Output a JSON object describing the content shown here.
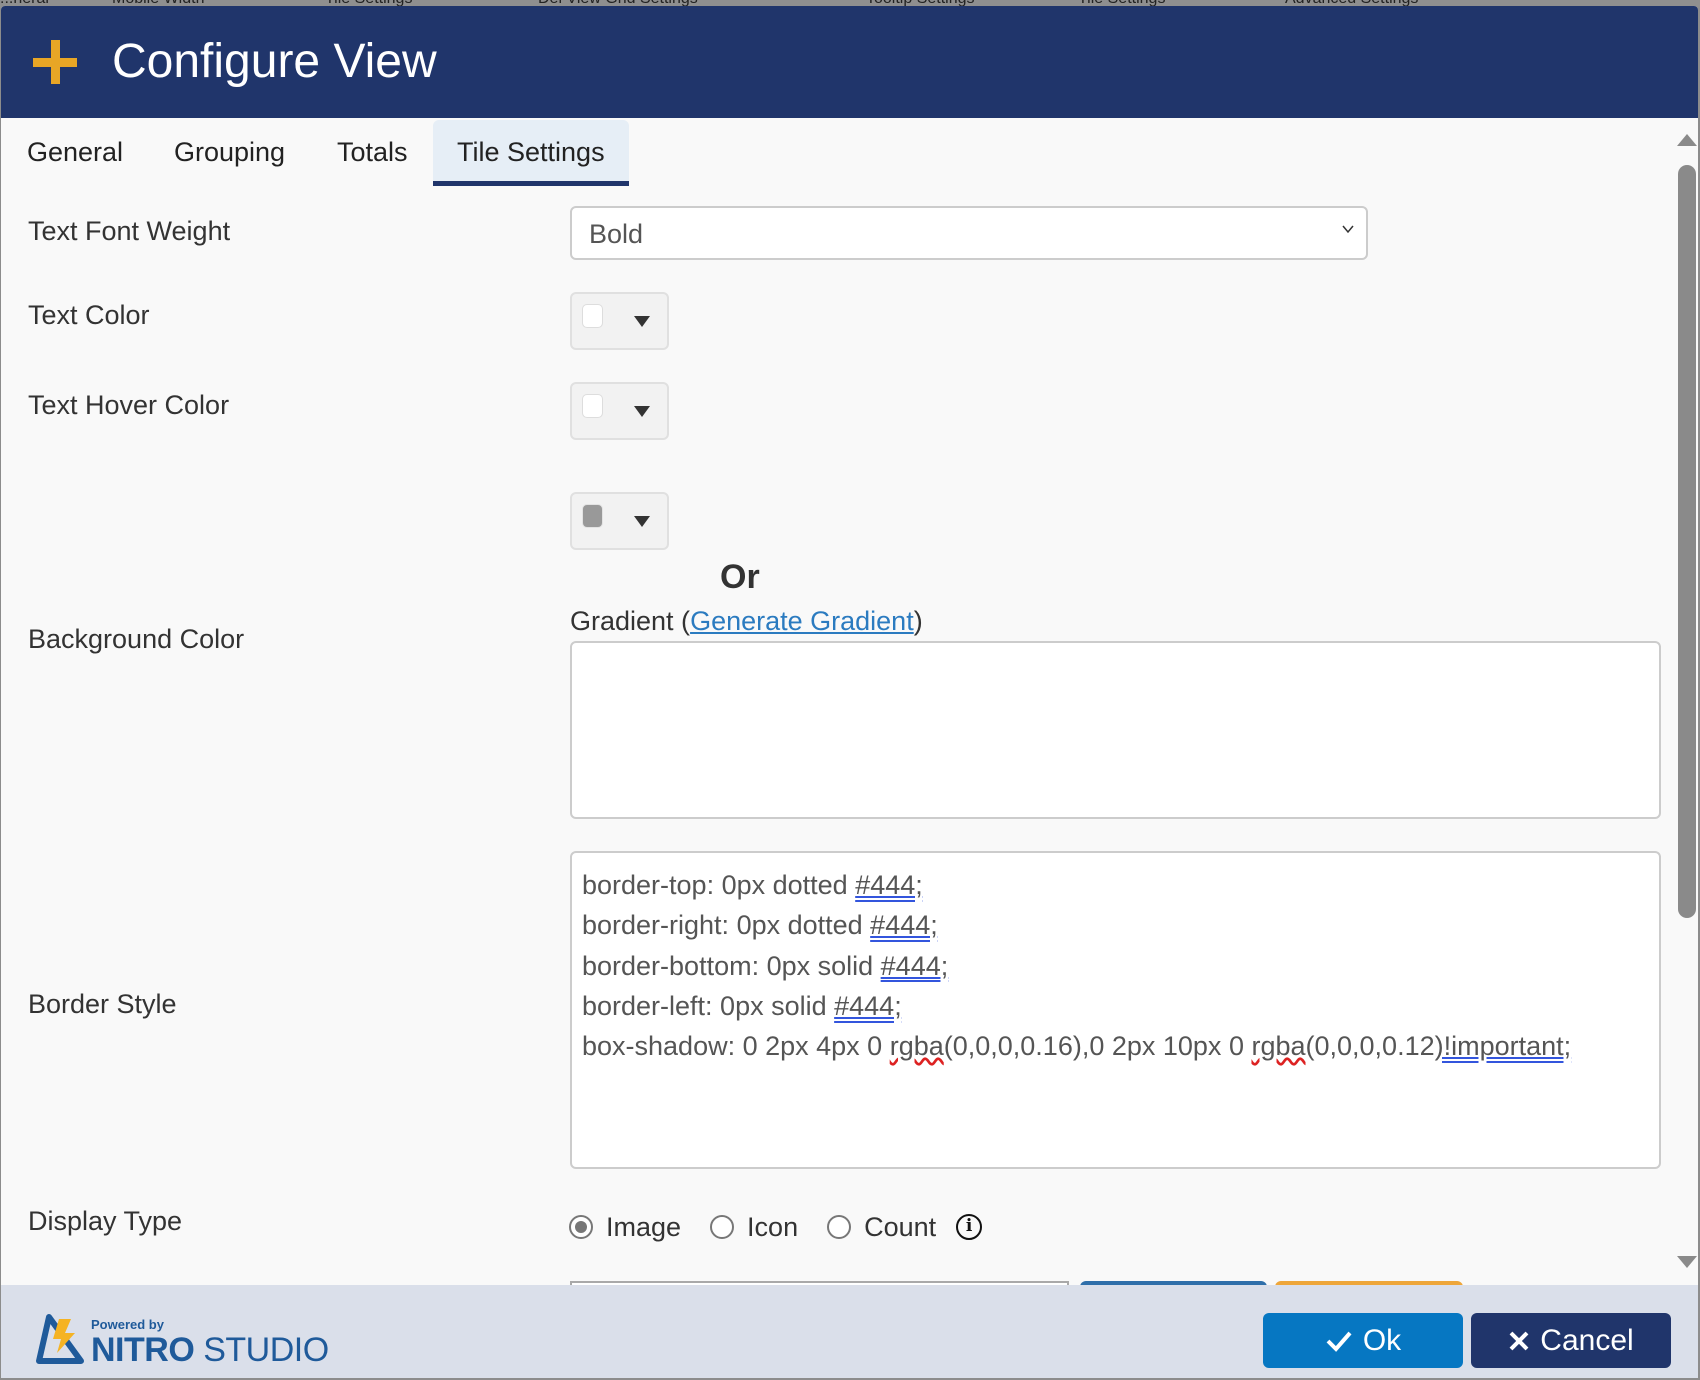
{
  "background_strip": [
    "...neral",
    "Mobile Width",
    "Tile Settings",
    "Del View Grid Settings",
    "Tooltip Settings",
    "Tile Settings",
    "Advanced Settings"
  ],
  "dialog": {
    "title": "Configure View",
    "title_icon": "plus-icon"
  },
  "tabs": [
    {
      "label": "General",
      "active": false
    },
    {
      "label": "Grouping",
      "active": false
    },
    {
      "label": "Totals",
      "active": false
    },
    {
      "label": "Tile Settings",
      "active": true
    }
  ],
  "fields": {
    "text_font_weight": {
      "label": "Text Font Weight",
      "value": "Bold"
    },
    "text_color": {
      "label": "Text Color",
      "swatch": "#ffffff"
    },
    "text_hover_color": {
      "label": "Text Hover Color",
      "swatch": "#ffffff"
    },
    "background_color": {
      "label": "Background Color",
      "swatch": "#999999",
      "or_label": "Or",
      "gradient_prefix": "Gradient (",
      "gradient_link": "Generate Gradient",
      "gradient_suffix": ")",
      "gradient_value": ""
    },
    "border_style": {
      "label": "Border Style",
      "lines": [
        {
          "text": "border-top: 0px dotted ",
          "mark": "#444;"
        },
        {
          "text": "border-right: 0px dotted ",
          "mark": "#444;"
        },
        {
          "text": "border-bottom: 0px solid ",
          "mark": "#444;"
        },
        {
          "text": "border-left: 0px solid ",
          "mark": "#444;"
        }
      ],
      "shadow_line": {
        "p1": "box-shadow: 0 2px 4px 0 ",
        "w1": "rgba",
        "p2": "(0,0,0,0.16),0 2px 10px 0 ",
        "w2": "rgba",
        "p3": "(0,0,0,0.12",
        "mark": ")!important;"
      }
    },
    "display_type": {
      "label": "Display Type",
      "options": [
        {
          "label": "Image",
          "checked": true
        },
        {
          "label": "Icon",
          "checked": false
        },
        {
          "label": "Count",
          "checked": false
        }
      ],
      "info_glyph": "i"
    }
  },
  "footer": {
    "powered_by": "Powered by",
    "brand_bold": "NITRO",
    "brand_rest": "STUDIO",
    "ok_label": "Ok",
    "cancel_label": "Cancel"
  },
  "colors": {
    "header": "#20356b",
    "accent": "#e8a626",
    "ok": "#0677c2",
    "cancel": "#20356b",
    "link": "#2b7bc0",
    "footer": "#dadfea"
  }
}
